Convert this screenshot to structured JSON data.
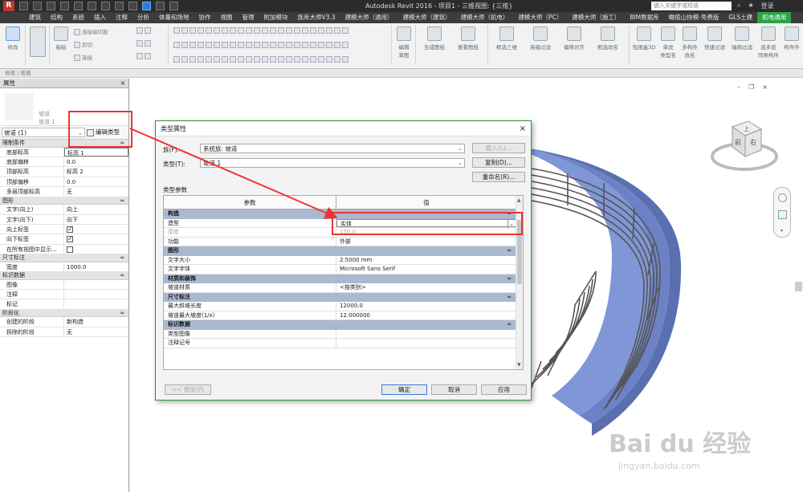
{
  "app": {
    "title": "Autodesk Revit 2016 -   项目1 - 三维视图: {三维}",
    "search_placeholder": "键入关键字或短语",
    "login": "登录",
    "logo": "R"
  },
  "ribbon": {
    "tabs": [
      "",
      "建筑",
      "结构",
      "系统",
      "插入",
      "注释",
      "分析",
      "体量和场地",
      "协作",
      "视图",
      "管理",
      "附加模块",
      "族库大师V3.3",
      "建模大师（通用）",
      "建模大师（建筑）",
      "建模大师（机电）",
      "建模大师（PC）",
      "建模大师（施工）",
      "BIM数据库",
      "橄榄山快模-免费版",
      "GLS土建",
      "机电通用"
    ],
    "active_tab_index": 21,
    "buttons": {
      "modify": "修改",
      "paste": "粘贴",
      "join_cut": "连接端切割",
      "cut": "剪切",
      "join": "连接",
      "edit_sketch": "编辑\n草图",
      "generate_plan": "生成图纸",
      "view_plan": "查看图纸",
      "filter_3d": "框选三维",
      "advanced_filter": "高级过滤",
      "offset_align": "偏移对齐",
      "filter_rename": "框选改名",
      "bbox_3d": "包围盒3D",
      "single_type": "单改\n类型名",
      "multi_type": "多构件\n改名",
      "quick_filter": "快速过滤",
      "axis_filter": "轴网过滤",
      "multi_layer": "选多层\n同类构件",
      "component_ext": "构件外"
    },
    "footer": "修改 | 坡道"
  },
  "properties": {
    "header": "属性",
    "close": "×",
    "preview_family": "坡道",
    "preview_type": "坡道 1",
    "selector": "坡道 (1)",
    "edit_type": "编辑类型",
    "sections": [
      {
        "title": "限制条件",
        "rows": [
          {
            "k": "底部标高",
            "v": "标高 1",
            "boxed": true
          },
          {
            "k": "底部偏移",
            "v": "0.0"
          },
          {
            "k": "顶部标高",
            "v": "标高 2"
          },
          {
            "k": "顶部偏移",
            "v": "0.0"
          },
          {
            "k": "多层顶部标高",
            "v": "无"
          }
        ]
      },
      {
        "title": "图形",
        "rows": [
          {
            "k": "文字(向上)",
            "v": "向上"
          },
          {
            "k": "文字(向下)",
            "v": "向下"
          },
          {
            "k": "向上标签",
            "v": "",
            "check": "on"
          },
          {
            "k": "向下标签",
            "v": "",
            "check": "on"
          },
          {
            "k": "在所有视图中显示...",
            "v": "",
            "check": "off"
          }
        ]
      },
      {
        "title": "尺寸标注",
        "rows": [
          {
            "k": "宽度",
            "v": "1000.0"
          }
        ]
      },
      {
        "title": "标识数据",
        "rows": [
          {
            "k": "图像",
            "v": ""
          },
          {
            "k": "注释",
            "v": ""
          },
          {
            "k": "标记",
            "v": ""
          }
        ]
      },
      {
        "title": "阶段化",
        "rows": [
          {
            "k": "创建的阶段",
            "v": "新构造"
          },
          {
            "k": "拆除的阶段",
            "v": "无"
          }
        ]
      }
    ]
  },
  "viewcube": {
    "top": "上",
    "front": "前",
    "right": "右"
  },
  "dialog": {
    "title": "类型属性",
    "family_label": "族(F):",
    "family_value": "系统族: 坡道",
    "type_label": "类型(T):",
    "type_value": "坡道 1",
    "load_btn": "载入(L)...",
    "duplicate_btn": "复制(D)...",
    "rename_btn": "重命名(R)...",
    "params_label": "类型参数",
    "col_param": "参数",
    "col_value": "值",
    "sections": [
      {
        "title": "构造",
        "rows": [
          {
            "k": "造型",
            "v": "实体",
            "combo": true
          },
          {
            "k": "厚度",
            "v": "150.0",
            "faded": true
          },
          {
            "k": "功能",
            "v": "外部"
          }
        ]
      },
      {
        "title": "图形",
        "rows": [
          {
            "k": "文字大小",
            "v": "2.5000 mm"
          },
          {
            "k": "文字字体",
            "v": "Microsoft Sans Serif"
          }
        ]
      },
      {
        "title": "材质和装饰",
        "rows": [
          {
            "k": "坡道材质",
            "v": "<按类别>"
          }
        ]
      },
      {
        "title": "尺寸标注",
        "rows": [
          {
            "k": "最大斜坡长度",
            "v": "12000.0"
          },
          {
            "k": "坡道最大坡度(1/x)",
            "v": "12.000000"
          }
        ]
      },
      {
        "title": "标识数据",
        "rows": [
          {
            "k": "类型图像",
            "v": ""
          },
          {
            "k": "注释记号",
            "v": ""
          }
        ]
      }
    ],
    "preview_btn": "<< 预览(P)",
    "ok_btn": "确定",
    "cancel_btn": "取消",
    "apply_btn": "应用"
  },
  "watermark": {
    "brand": "Bai du 经验",
    "url": "jingyan.baidu.com"
  },
  "colors": {
    "active_tab": "#2aa345",
    "annotation": "#e33333",
    "ramp": "#7f97d6",
    "section_header": "#a9b9ce"
  }
}
